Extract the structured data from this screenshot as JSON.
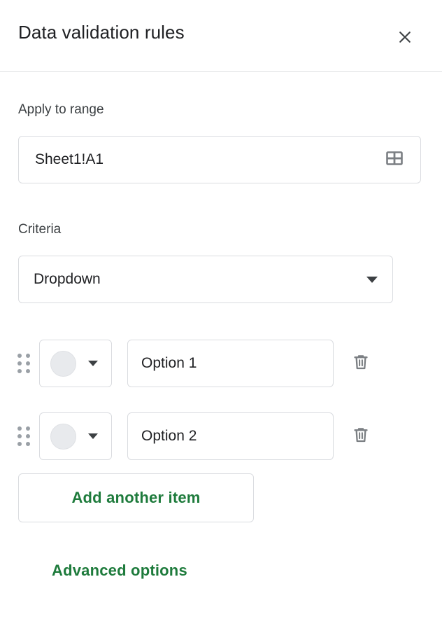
{
  "dialog": {
    "title": "Data validation rules",
    "close_icon": "close-icon"
  },
  "range_section": {
    "label": "Apply to range",
    "value": "Sheet1!A1",
    "picker_icon": "grid-table-icon"
  },
  "criteria_section": {
    "label": "Criteria",
    "selected": "Dropdown",
    "caret_icon": "chevron-down-icon"
  },
  "options": [
    {
      "drag_icon": "drag-handle-icon",
      "color": "#e8eaed",
      "color_caret_icon": "chevron-down-icon",
      "value": "Option 1",
      "delete_icon": "trash-icon"
    },
    {
      "drag_icon": "drag-handle-icon",
      "color": "#e8eaed",
      "color_caret_icon": "chevron-down-icon",
      "value": "Option 2",
      "delete_icon": "trash-icon"
    }
  ],
  "actions": {
    "add_item_label": "Add another item",
    "advanced_label": "Advanced options",
    "accent_color": "#1e7b3c"
  }
}
